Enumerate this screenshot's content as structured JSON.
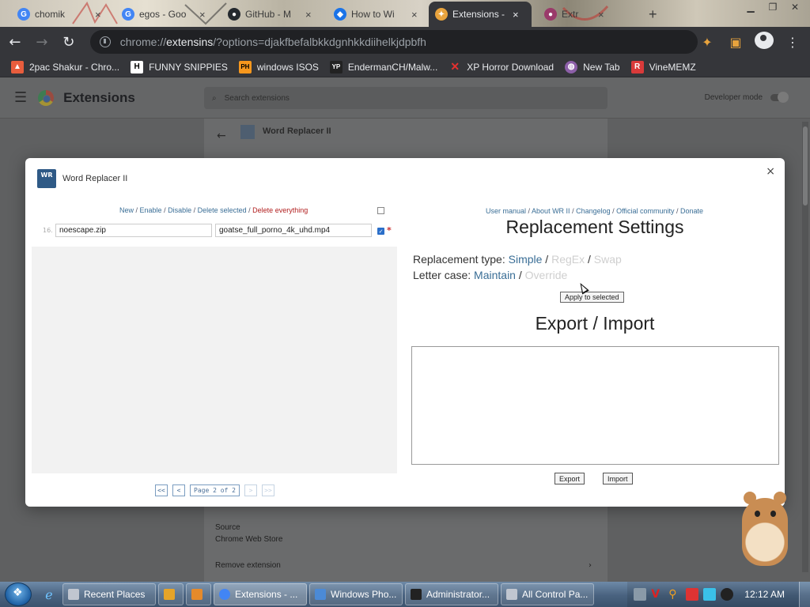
{
  "browser": {
    "tabs": [
      {
        "title": "chomik",
        "icon": "google-icon",
        "color": "#4285f4",
        "glyph": "G"
      },
      {
        "title": "egos - Goo",
        "icon": "google-icon",
        "color": "#4285f4",
        "glyph": "G"
      },
      {
        "title": "GitHub - M",
        "icon": "github-icon",
        "color": "#24292e",
        "glyph": "●"
      },
      {
        "title": "How to Wi",
        "icon": "page-icon",
        "color": "#1a73e8",
        "glyph": "◆"
      },
      {
        "title": "Extensions -",
        "icon": "extensions-icon",
        "color": "#e8a33d",
        "glyph": "✦",
        "active": true
      },
      {
        "title": "Extr",
        "icon": "page-icon",
        "color": "#9a3a6a",
        "glyph": "●"
      }
    ],
    "new_tab": "+",
    "address": {
      "scheme": "chrome://",
      "host": "extensins",
      "path": "/?options=djakfbefalbkkdgnhkkdiihelkjdpbfh"
    },
    "bookmarks": [
      {
        "label": "2pac Shakur - Chro...",
        "icon": "bookmark-folder-icon",
        "glyph": "▲",
        "color": "#e85d3d",
        "fg": "#fff"
      },
      {
        "label": "FUNNY SNIPPIES",
        "icon": "h-logo-icon",
        "glyph": "H",
        "color": "#ffffff",
        "fg": "#000"
      },
      {
        "label": "windows ISOS",
        "icon": "ph-logo-icon",
        "glyph": "PH",
        "color": "#f7971d",
        "fg": "#000"
      },
      {
        "label": "EndermanCH/Malw...",
        "icon": "yp-logo-icon",
        "glyph": "YP",
        "color": "#222222",
        "fg": "#fff"
      },
      {
        "label": "XP Horror Download",
        "icon": "x-logo-icon",
        "glyph": "X",
        "color": "#35363a",
        "fg": "#e5312f"
      },
      {
        "label": "New Tab",
        "icon": "globe-icon",
        "glyph": "◍",
        "color": "#8c5fa8",
        "fg": "#fff"
      },
      {
        "label": "VineMEMZ",
        "icon": "r-logo-icon",
        "glyph": "R",
        "color": "#d93a3a",
        "fg": "#fff"
      }
    ]
  },
  "extensions_page": {
    "title": "Extensions",
    "search_placeholder": "Search extensions",
    "developer_mode_label": "Developer mode",
    "detail_name": "Word Replacer II",
    "source_label": "Source",
    "source_value": "Chrome Web Store",
    "remove_label": "Remove extension"
  },
  "dialog": {
    "logo_text": "WR",
    "title": "Word Replacer II",
    "close": "×",
    "left_links": {
      "new": "New",
      "enable": "Enable",
      "disable": "Disable",
      "delete_selected": "Delete selected",
      "delete_everything": "Delete everything",
      "sep": " / "
    },
    "rules": [
      {
        "num": "16.",
        "from": "noescape.zip",
        "to": "goatse_full_porno_4k_uhd.mp4",
        "checked": true,
        "star": "*"
      }
    ],
    "pager": {
      "first": "<<",
      "prev": "<",
      "info": "Page 2 of 2",
      "next": ">",
      "last": ">>"
    },
    "right_links": {
      "manual": "User manual",
      "about": "About WR II",
      "changelog": "Changelog",
      "community": "Official community",
      "donate": "Donate",
      "sep": " / "
    },
    "settings_title": "Replacement Settings",
    "replacement_type": {
      "label": "Replacement type:",
      "simple": "Simple",
      "regex": "RegEx",
      "swap": "Swap",
      "sep": " / "
    },
    "letter_case": {
      "label": "Letter case:",
      "maintain": "Maintain",
      "override": "Override",
      "sep": " / "
    },
    "apply_button": "Apply to selected",
    "export_import_title": "Export / Import",
    "export_button": "Export",
    "import_button": "Import"
  },
  "taskbar": {
    "tasks": [
      {
        "label": "Recent Places",
        "color": "#c0c6d0"
      },
      {
        "label": "",
        "color": "#e6a428"
      },
      {
        "label": "",
        "color": "#e58a2b"
      },
      {
        "label": "Extensions - ...",
        "color": "#4285f4",
        "active": true
      },
      {
        "label": "Windows Pho...",
        "color": "#4b8ad6"
      },
      {
        "label": "Administrator...",
        "color": "#222222"
      },
      {
        "label": "All Control Pa...",
        "color": "#c0c6d0"
      }
    ],
    "clock": "12:12 AM"
  }
}
